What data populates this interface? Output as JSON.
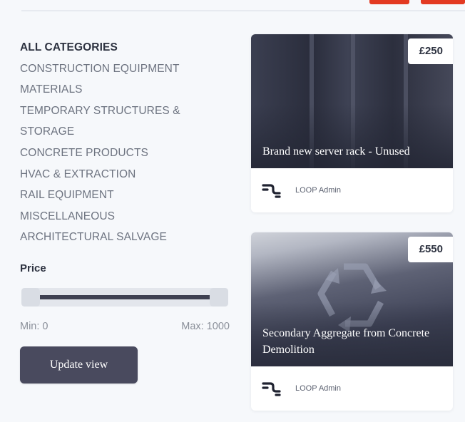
{
  "categories": [
    {
      "label": "ALL CATEGORIES"
    },
    {
      "label": "CONSTRUCTION EQUIPMENT"
    },
    {
      "label": "MATERIALS"
    },
    {
      "label": "TEMPORARY STRUCTURES &"
    },
    {
      "label": "STORAGE"
    },
    {
      "label": "CONCRETE PRODUCTS"
    },
    {
      "label": "HVAC & EXTRACTION"
    },
    {
      "label": "RAIL EQUIPMENT"
    },
    {
      "label": "MISCELLANEOUS"
    },
    {
      "label": "ARCHITECTURAL SALVAGE"
    }
  ],
  "price_filter": {
    "title": "Price",
    "min_label": "Min: 0",
    "max_label": "Max: 1000",
    "range_min": 0,
    "range_max": 1000,
    "selected_min": 0,
    "selected_max": 1000
  },
  "update_button": {
    "label": "Update view"
  },
  "listings": [
    {
      "price": "£250",
      "title": "Brand new server rack - Unused",
      "author": "LOOP Admin",
      "image_icon": "server-rack-photo"
    },
    {
      "price": "£550",
      "title": "Secondary Aggregate from Concrete Demolition",
      "author": "LOOP Admin",
      "image_icon": "recycling-aggregate-photo"
    }
  ],
  "colors": {
    "accent": "#e33a22",
    "button": "#494a5e",
    "slider_fill": "#3f4152"
  }
}
